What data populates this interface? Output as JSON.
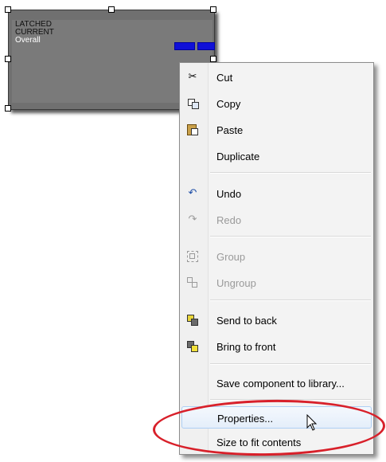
{
  "widget": {
    "line1": "LATCHED",
    "line2": "CURRENT",
    "line3": "Overall"
  },
  "context_menu": {
    "items": [
      {
        "label": "Cut",
        "icon": "scissors-icon",
        "enabled": true
      },
      {
        "label": "Copy",
        "icon": "copy-icon",
        "enabled": true
      },
      {
        "label": "Paste",
        "icon": "paste-icon",
        "enabled": true
      },
      {
        "label": "Duplicate",
        "icon": "",
        "enabled": true
      },
      {
        "label": "Undo",
        "icon": "undo-icon",
        "enabled": true
      },
      {
        "label": "Redo",
        "icon": "redo-icon",
        "enabled": false
      },
      {
        "label": "Group",
        "icon": "group-icon",
        "enabled": false
      },
      {
        "label": "Ungroup",
        "icon": "ungroup-icon",
        "enabled": false
      },
      {
        "label": "Send to back",
        "icon": "send-to-back-icon",
        "enabled": true
      },
      {
        "label": "Bring to front",
        "icon": "bring-to-front-icon",
        "enabled": true
      },
      {
        "label": "Save component to library...",
        "icon": "",
        "enabled": true
      },
      {
        "label": "Properties...",
        "icon": "",
        "enabled": true,
        "highlighted": true
      },
      {
        "label": "Size to fit contents",
        "icon": "",
        "enabled": true
      }
    ]
  },
  "colors": {
    "highlight_ellipse": "#d8202a",
    "widget_bar": "#1010d8",
    "widget_bg": "#707070"
  }
}
